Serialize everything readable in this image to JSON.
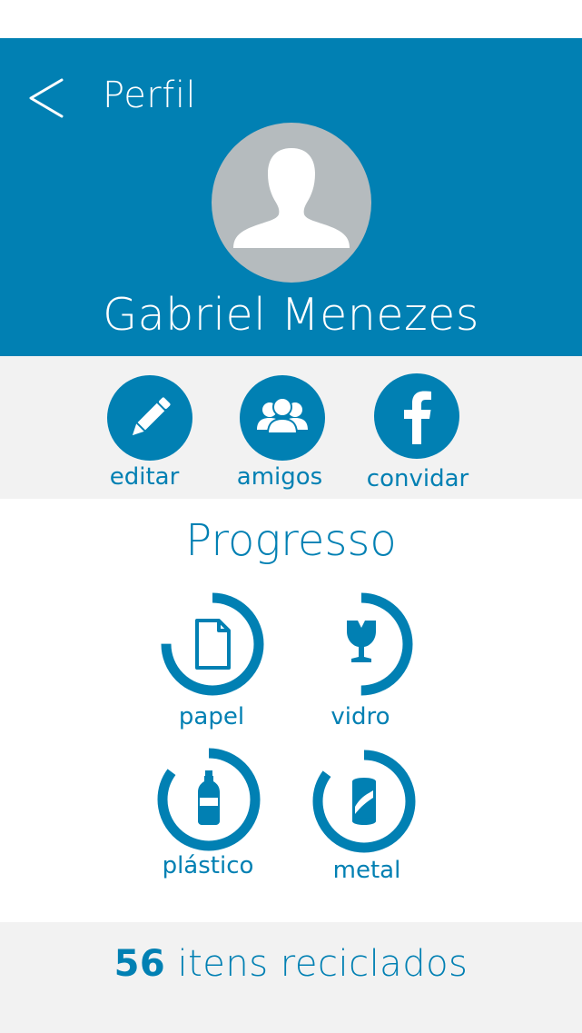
{
  "header": {
    "title": "Perfil",
    "back_icon": "chevron-left-icon"
  },
  "profile": {
    "name": "Gabriel Menezes",
    "avatar_icon": "user-silhouette-icon"
  },
  "actions": [
    {
      "label": "editar",
      "icon": "pencil-icon"
    },
    {
      "label": "amigos",
      "icon": "users-icon"
    },
    {
      "label": "convidar",
      "icon": "facebook-icon"
    }
  ],
  "progress": {
    "title": "Progresso",
    "categories": [
      {
        "label": "papel",
        "icon": "document-icon",
        "fill": 0.75
      },
      {
        "label": "vidro",
        "icon": "broken-glass-icon",
        "fill": 0.5
      },
      {
        "label": "plástico",
        "icon": "bottle-icon",
        "fill": 0.85
      },
      {
        "label": "metal",
        "icon": "can-icon",
        "fill": 0.85
      }
    ]
  },
  "footer": {
    "count": "56",
    "text": "itens reciclados"
  },
  "colors": {
    "primary": "#0180b3",
    "band": "#f2f2f2",
    "avatar_bg": "#b5bbbe"
  }
}
